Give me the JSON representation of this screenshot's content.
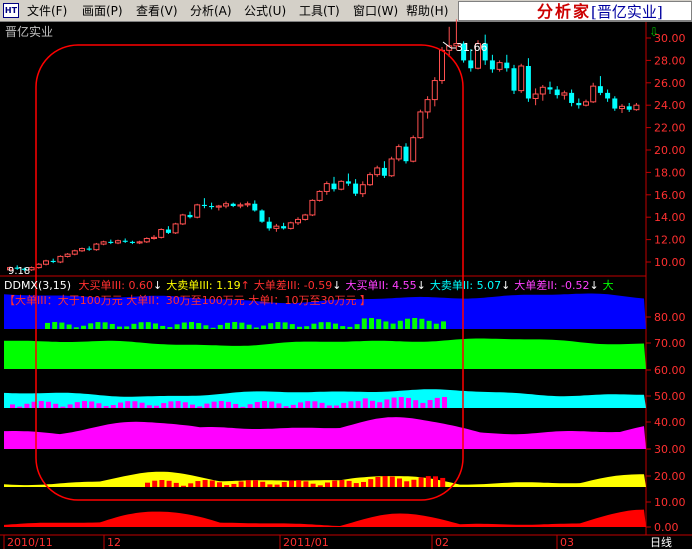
{
  "menu": {
    "app_icon": "HT",
    "items": [
      {
        "label": "文件(F)"
      },
      {
        "label": "画面(P)"
      },
      {
        "label": "查看(V)"
      },
      {
        "label": "分析(A)"
      },
      {
        "label": "公式(U)"
      },
      {
        "label": "工具(T)"
      },
      {
        "label": "窗口(W)"
      },
      {
        "label": "帮助(H)"
      }
    ],
    "brand_main": "分析家",
    "brand_sub": "[晋亿实业]"
  },
  "stock": {
    "name": "晋亿实业",
    "high_label": "31.66",
    "low_label": "9.18"
  },
  "price_axis": {
    "labels": [
      "30.00",
      "28.00",
      "26.00",
      "24.00",
      "22.00",
      "20.00",
      "18.00",
      "16.00",
      "14.00",
      "12.00",
      "10.00"
    ]
  },
  "indicator": {
    "title": "DDMX(3,15)",
    "items": [
      {
        "text": "大买单III: 0.60",
        "color": "#ff3030",
        "arrow": "↓",
        "arrow_color": "#ffffff"
      },
      {
        "text": "大卖单III: 1.19",
        "color": "#ffff00",
        "arrow": "↑",
        "arrow_color": "#ff3030"
      },
      {
        "text": "大单差III: -0.59",
        "color": "#ff3030",
        "arrow": "↓",
        "arrow_color": "#ffffff"
      },
      {
        "text": "大买单II: 4.55",
        "color": "#ff40ff",
        "arrow": "↓",
        "arrow_color": "#ffffff"
      },
      {
        "text": "大卖单II: 5.07",
        "color": "#00ffff",
        "arrow": "↓",
        "arrow_color": "#ffffff"
      },
      {
        "text": "大单差II: -0.52",
        "color": "#ff40ff",
        "arrow": "↓",
        "arrow_color": "#ffffff"
      },
      {
        "text": "大",
        "color": "#00ff00",
        "arrow": "",
        "arrow_color": "#ffffff"
      }
    ],
    "legend": "【大单III：大于100万元   大单II：30万至100万元   大单I：10万至30万元  】"
  },
  "indicator_axis": {
    "labels": [
      "80.00",
      "70.00",
      "60.00",
      "50.00",
      "40.00",
      "30.00",
      "20.00",
      "10.00",
      "0.00"
    ]
  },
  "time_axis": {
    "labels": [
      "2010/11",
      "12",
      "2011/01",
      "02",
      "03"
    ],
    "period": "日线"
  },
  "colors": {
    "up": "#ff5050",
    "down": "#00ffff",
    "band_blue": "#0000ff",
    "band_green": "#00ff00",
    "band_cyan": "#00ffff",
    "band_magenta": "#ff00ff",
    "band_yellow": "#ffff00",
    "band_red": "#ff0000",
    "axis": "#c00000",
    "highlight": "#ff0000"
  },
  "chart_data": {
    "type": "candlestick",
    "ylim": [
      9,
      31
    ],
    "candles": [
      [
        9.3,
        9.6,
        9.2,
        9.5
      ],
      [
        9.5,
        9.7,
        9.3,
        9.4
      ],
      [
        9.4,
        9.5,
        9.18,
        9.3
      ],
      [
        9.3,
        9.6,
        9.2,
        9.5
      ],
      [
        9.5,
        9.9,
        9.4,
        9.8
      ],
      [
        9.8,
        10.2,
        9.7,
        10.1
      ],
      [
        10.1,
        10.3,
        9.9,
        10.0
      ],
      [
        10.0,
        10.6,
        9.9,
        10.5
      ],
      [
        10.5,
        10.8,
        10.4,
        10.7
      ],
      [
        10.7,
        11.1,
        10.6,
        11.0
      ],
      [
        11.0,
        11.3,
        10.9,
        11.2
      ],
      [
        11.2,
        11.4,
        11.0,
        11.1
      ],
      [
        11.1,
        11.7,
        11.0,
        11.6
      ],
      [
        11.6,
        11.9,
        11.5,
        11.8
      ],
      [
        11.8,
        12.0,
        11.6,
        11.7
      ],
      [
        11.7,
        12.0,
        11.6,
        11.9
      ],
      [
        11.9,
        12.1,
        11.7,
        11.8
      ],
      [
        11.8,
        11.9,
        11.6,
        11.7
      ],
      [
        11.7,
        11.9,
        11.6,
        11.8
      ],
      [
        11.8,
        12.2,
        11.7,
        12.1
      ],
      [
        12.1,
        12.4,
        12.0,
        12.2
      ],
      [
        12.2,
        13.0,
        12.1,
        12.9
      ],
      [
        12.9,
        13.2,
        12.5,
        12.6
      ],
      [
        12.6,
        13.5,
        12.5,
        13.4
      ],
      [
        13.4,
        14.3,
        13.3,
        14.2
      ],
      [
        14.2,
        14.5,
        13.9,
        14.0
      ],
      [
        14.0,
        15.2,
        13.9,
        15.1
      ],
      [
        15.1,
        15.7,
        14.8,
        15.0
      ],
      [
        15.0,
        15.3,
        14.7,
        14.9
      ],
      [
        14.9,
        15.1,
        14.6,
        15.0
      ],
      [
        15.0,
        15.4,
        14.8,
        15.2
      ],
      [
        15.2,
        15.3,
        14.9,
        15.0
      ],
      [
        15.0,
        15.3,
        14.8,
        15.1
      ],
      [
        15.1,
        15.4,
        14.9,
        15.2
      ],
      [
        15.2,
        15.5,
        14.5,
        14.6
      ],
      [
        14.6,
        14.7,
        13.5,
        13.6
      ],
      [
        13.6,
        14.0,
        12.8,
        13.0
      ],
      [
        13.0,
        13.4,
        12.7,
        13.2
      ],
      [
        13.2,
        13.5,
        12.9,
        13.0
      ],
      [
        13.0,
        13.6,
        12.9,
        13.5
      ],
      [
        13.5,
        14.0,
        13.3,
        13.8
      ],
      [
        13.8,
        14.3,
        13.7,
        14.2
      ],
      [
        14.2,
        15.6,
        14.1,
        15.5
      ],
      [
        15.5,
        16.4,
        15.4,
        16.3
      ],
      [
        16.3,
        17.2,
        16.0,
        17.0
      ],
      [
        17.0,
        17.6,
        16.3,
        16.5
      ],
      [
        16.5,
        17.3,
        16.4,
        17.2
      ],
      [
        17.2,
        17.9,
        16.8,
        17.0
      ],
      [
        17.0,
        17.4,
        15.9,
        16.1
      ],
      [
        16.1,
        17.2,
        15.8,
        16.9
      ],
      [
        16.9,
        18.0,
        16.8,
        17.8
      ],
      [
        17.8,
        18.6,
        17.6,
        18.4
      ],
      [
        18.4,
        19.0,
        17.5,
        17.7
      ],
      [
        17.7,
        19.4,
        17.6,
        19.2
      ],
      [
        19.2,
        20.5,
        19.0,
        20.3
      ],
      [
        20.3,
        20.6,
        18.8,
        19.0
      ],
      [
        19.0,
        21.3,
        18.9,
        21.1
      ],
      [
        21.1,
        23.6,
        21.0,
        23.4
      ],
      [
        23.4,
        24.8,
        22.8,
        24.5
      ],
      [
        24.5,
        26.5,
        23.9,
        26.2
      ],
      [
        26.2,
        29.2,
        25.9,
        28.9
      ],
      [
        28.9,
        31.0,
        28.3,
        29.3
      ],
      [
        29.3,
        31.66,
        28.9,
        29.5
      ],
      [
        29.5,
        29.7,
        27.8,
        28.0
      ],
      [
        28.0,
        29.0,
        27.0,
        27.3
      ],
      [
        27.3,
        29.8,
        27.2,
        29.5
      ],
      [
        29.5,
        30.3,
        27.6,
        28.0
      ],
      [
        28.0,
        28.5,
        26.9,
        27.2
      ],
      [
        27.2,
        28.0,
        27.0,
        27.8
      ],
      [
        27.8,
        28.5,
        27.0,
        27.3
      ],
      [
        27.3,
        27.6,
        25.0,
        25.3
      ],
      [
        25.3,
        27.7,
        25.1,
        27.5
      ],
      [
        27.5,
        28.2,
        24.3,
        24.6
      ],
      [
        24.6,
        25.5,
        24.0,
        25.0
      ],
      [
        25.0,
        25.8,
        24.4,
        25.6
      ],
      [
        25.6,
        26.1,
        25.0,
        25.4
      ],
      [
        25.4,
        25.7,
        24.6,
        24.9
      ],
      [
        24.9,
        25.3,
        24.5,
        25.1
      ],
      [
        25.1,
        25.4,
        23.9,
        24.2
      ],
      [
        24.2,
        24.6,
        23.7,
        24.0
      ],
      [
        24.0,
        24.5,
        23.9,
        24.3
      ],
      [
        24.3,
        26.0,
        24.2,
        25.7
      ],
      [
        25.7,
        26.6,
        24.9,
        25.1
      ],
      [
        25.1,
        25.4,
        24.3,
        24.6
      ],
      [
        24.6,
        24.8,
        23.5,
        23.7
      ],
      [
        23.7,
        24.1,
        23.3,
        23.9
      ],
      [
        23.9,
        24.2,
        23.4,
        23.6
      ],
      [
        23.6,
        24.2,
        23.5,
        24.0
      ]
    ]
  }
}
